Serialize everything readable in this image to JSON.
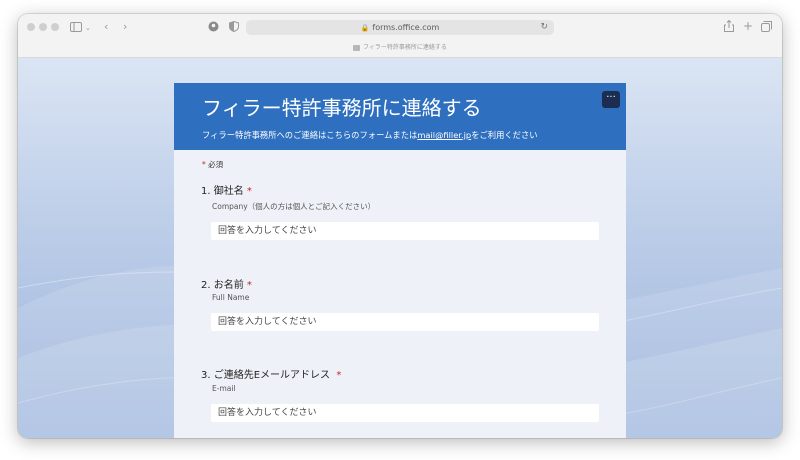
{
  "browser": {
    "url": "forms.office.com",
    "tab_title": "フィラー特許事務所に連絡する"
  },
  "form": {
    "title": "フィラー特許事務所に連絡する",
    "description_prefix": "フィラー特許事務所へのご連絡はこちらのフォームまたは",
    "description_email": "mail@filler.jp",
    "description_suffix": "をご利用ください",
    "more_button": "···",
    "required_star": "*",
    "required_label": "必須",
    "answer_placeholder": "回答を入力してください",
    "questions": [
      {
        "number": "1.",
        "title": "御社名",
        "required": "*",
        "subtitle": "Company（個人の方は個人とご記入ください）"
      },
      {
        "number": "2.",
        "title": "お名前",
        "required": "*",
        "subtitle": "Full Name"
      },
      {
        "number": "3.",
        "title": "ご連絡先Eメールアドレス",
        "required": "*",
        "subtitle": "E-mail"
      }
    ]
  },
  "colors": {
    "header": "#2e6fc0",
    "required_star": "#c4262e",
    "more_button_bg": "#1b2e52"
  }
}
